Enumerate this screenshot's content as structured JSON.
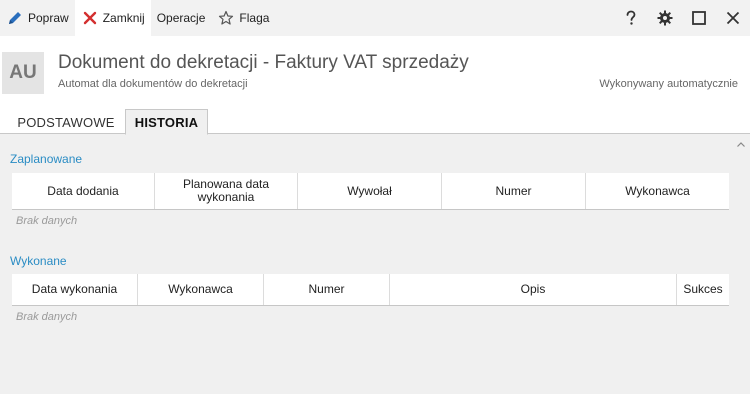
{
  "toolbar": {
    "buttons": [
      {
        "label": "Popraw",
        "icon": "pencil-icon"
      },
      {
        "label": "Zamknij",
        "icon": "close-x-icon"
      },
      {
        "label": "Operacje"
      },
      {
        "label": "Flaga",
        "icon": "star-icon"
      }
    ],
    "right_icons": [
      "help-icon",
      "gear-icon",
      "maximize-icon",
      "close-icon"
    ],
    "colors": {
      "accent": "#2a6fbd",
      "close": "#d32f2f"
    }
  },
  "header": {
    "avatar": "AU",
    "title": "Dokument do dekretacji - Faktury VAT sprzedaży",
    "subtitle": "Automat dla dokumentów do dekretacji",
    "status": "Wykonywany automatycznie"
  },
  "tabs": [
    {
      "label": "PODSTAWOWE",
      "active": false
    },
    {
      "label": "HISTORIA",
      "active": true
    }
  ],
  "planned": {
    "title": "Zaplanowane",
    "columns": [
      "Data dodania",
      "Planowana data wykonania",
      "Wywołał",
      "Numer",
      "Wykonawca"
    ],
    "empty": "Brak danych"
  },
  "executed": {
    "title": "Wykonane",
    "columns": [
      "Data wykonania",
      "Wykonawca",
      "Numer",
      "Opis",
      "Sukces"
    ],
    "empty": "Brak danych"
  },
  "section_color": "#2a8cc4"
}
